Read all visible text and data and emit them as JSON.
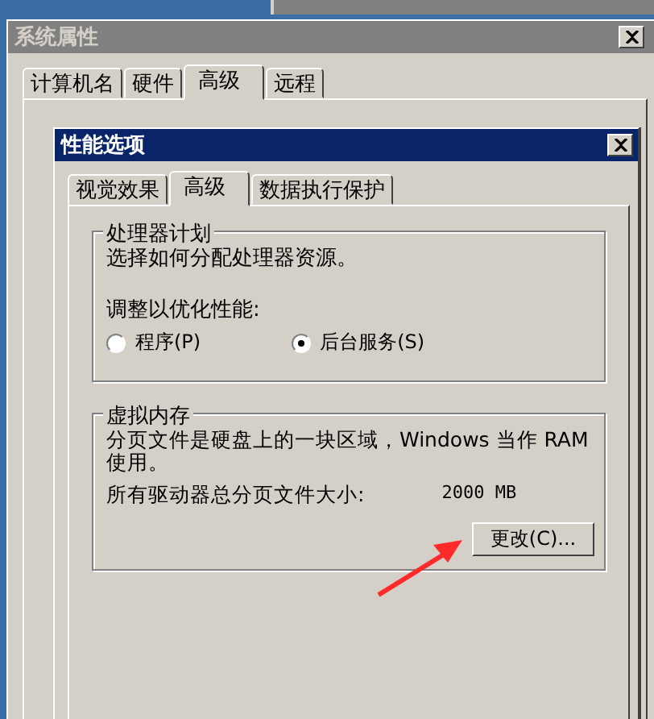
{
  "back_window": {
    "title": "系统属性",
    "active": false,
    "tabs": [
      {
        "label": "计算机名",
        "selected": false
      },
      {
        "label": "硬件",
        "selected": false
      },
      {
        "label": "高级",
        "selected": true
      },
      {
        "label": "远程",
        "selected": false
      }
    ]
  },
  "dialog": {
    "title": "性能选项",
    "active": true,
    "tabs": [
      {
        "label": "视觉效果",
        "selected": false
      },
      {
        "label": "高级",
        "selected": true
      },
      {
        "label": "数据执行保护",
        "selected": false
      }
    ],
    "processor_group": {
      "legend": "处理器计划",
      "description": "选择如何分配处理器资源。",
      "prompt": "调整以优化性能:",
      "options": [
        {
          "label": "程序(P)",
          "selected": false
        },
        {
          "label": "后台服务(S)",
          "selected": true
        }
      ]
    },
    "memory_group": {
      "legend": "虚拟内存",
      "description": "分页文件是硬盘上的一块区域，Windows 当作 RAM 使用。",
      "size_label": "所有驱动器总分页文件大小:",
      "size_value": "2000 MB",
      "button": "更改(C)..."
    }
  }
}
